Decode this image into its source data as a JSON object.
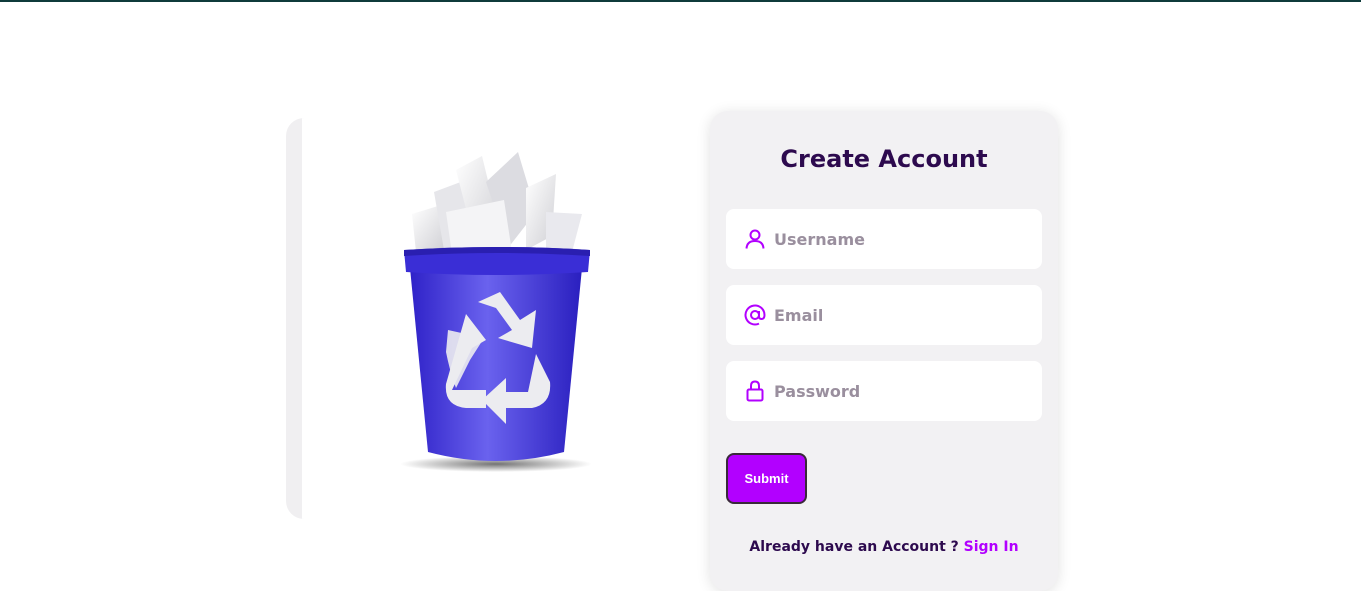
{
  "form": {
    "title": "Create Account",
    "username_placeholder": "Username",
    "email_placeholder": "Email",
    "password_placeholder": "Password",
    "submit_label": "Submit",
    "signin_prompt": "Already have an Account ? ",
    "signin_link_label": "Sign In"
  },
  "icons": {
    "username": "user-icon",
    "email": "at-sign-icon",
    "password": "lock-icon",
    "illustration": "recycle-bin-icon"
  },
  "colors": {
    "accent": "#b200ff",
    "title": "#2d0a4e",
    "bin": "#4a3fe0",
    "card_bg": "#f2f1f3"
  }
}
